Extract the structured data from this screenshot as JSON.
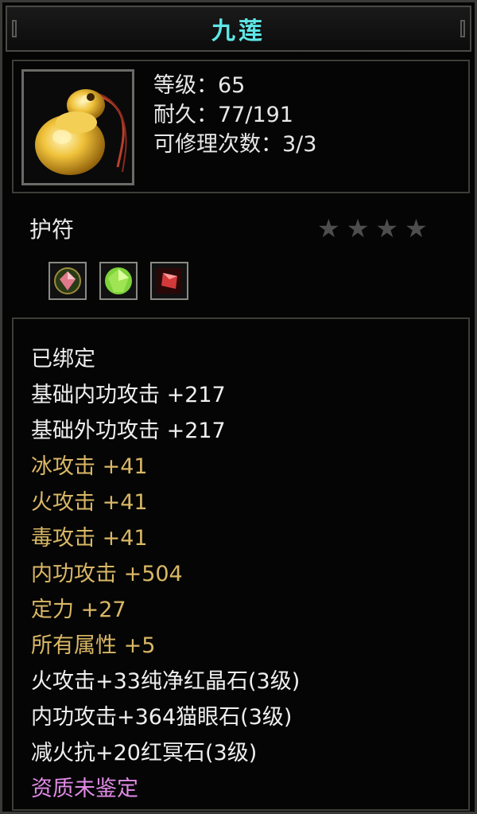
{
  "item": {
    "name": "九莲",
    "level_line": "等级：65",
    "durability_line": "耐久：77/191",
    "repair_line": "可修理次数：3/3",
    "type": "护符",
    "stars_total": 4,
    "icon": "gourd-amulet-icon"
  },
  "gem_slots": [
    {
      "name": "pink-gem-icon",
      "color": "#e07a8a"
    },
    {
      "name": "green-gem-icon",
      "color": "#7ed23a"
    },
    {
      "name": "red-gem-icon",
      "color": "#d23a3a"
    }
  ],
  "properties": [
    {
      "text": "已绑定",
      "style": "white"
    },
    {
      "text": "基础内功攻击  +217",
      "style": "white"
    },
    {
      "text": "基础外功攻击  +217",
      "style": "white"
    },
    {
      "text": "冰攻击  +41",
      "style": "gold"
    },
    {
      "text": "火攻击  +41",
      "style": "gold"
    },
    {
      "text": "毒攻击  +41",
      "style": "gold"
    },
    {
      "text": "内功攻击  +504",
      "style": "gold"
    },
    {
      "text": "定力  +27",
      "style": "gold"
    },
    {
      "text": "所有属性  +5",
      "style": "gold"
    },
    {
      "text": "火攻击+33纯净红晶石(3级)",
      "style": "white"
    },
    {
      "text": "内功攻击+364猫眼石(3级)",
      "style": "white"
    },
    {
      "text": "减火抗+20红冥石(3级)",
      "style": "white"
    },
    {
      "text": "资质未鉴定",
      "style": "purple"
    }
  ],
  "colors": {
    "title": "#5fe6e6",
    "white_text": "#efefef",
    "gold_text": "#d9b765",
    "purple_text": "#e08ae6",
    "star_inactive": "#4d4d4d"
  }
}
